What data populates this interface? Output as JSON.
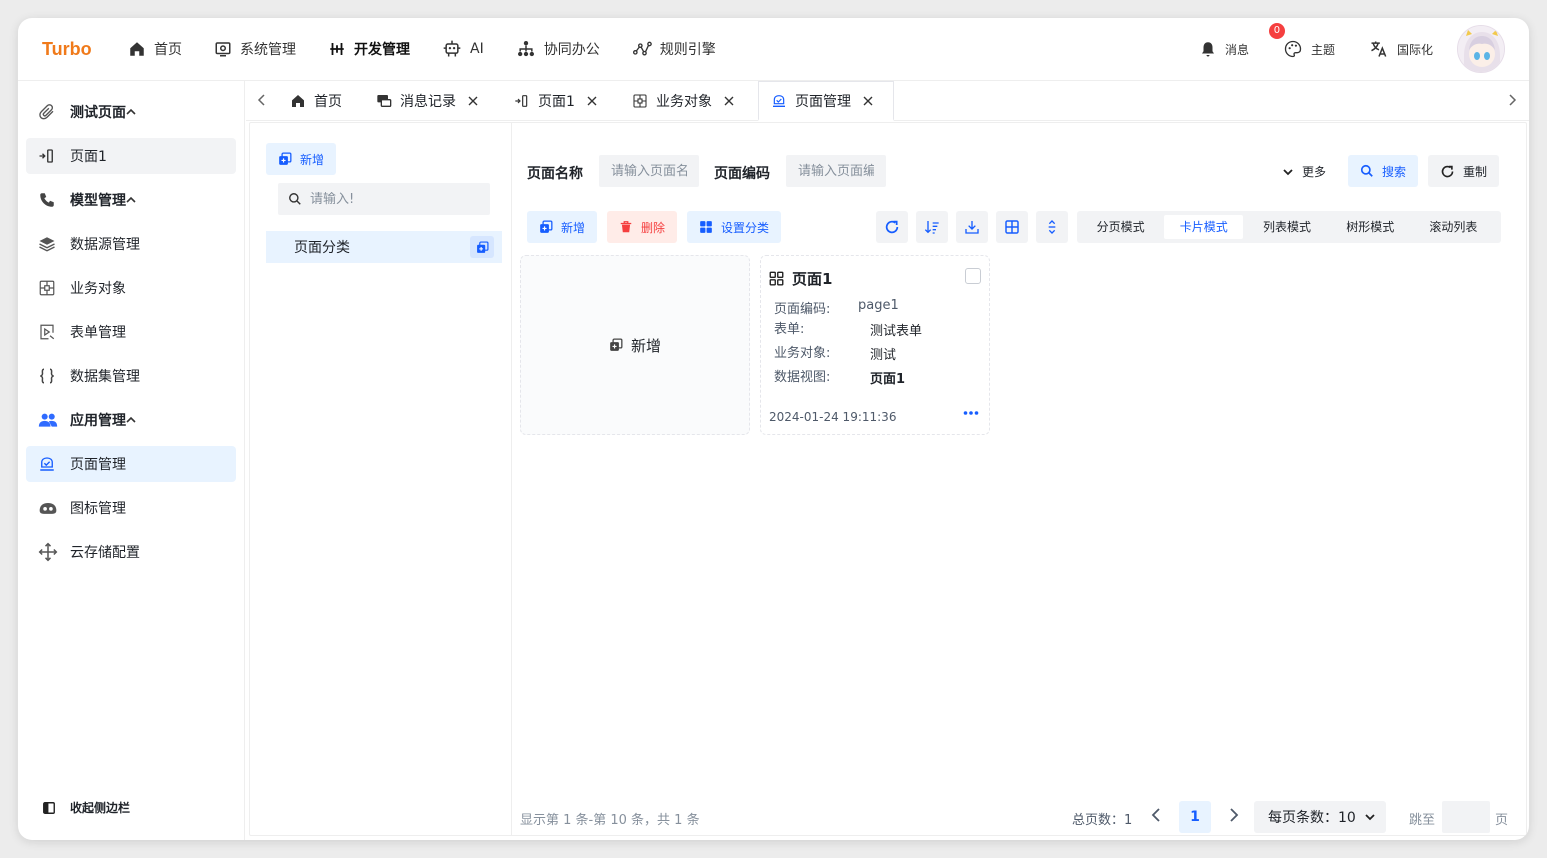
{
  "app": {
    "logo": "Turbo"
  },
  "topnav": [
    {
      "label": "首页",
      "icon": "home-icon"
    },
    {
      "label": "系统管理",
      "icon": "monitor-icon"
    },
    {
      "label": "开发管理",
      "icon": "dev-icon",
      "active": true
    },
    {
      "label": "AI",
      "icon": "robot-icon"
    },
    {
      "label": "协同办公",
      "icon": "org-icon"
    },
    {
      "label": "规则引擎",
      "icon": "rule-icon"
    }
  ],
  "topright": {
    "messages": {
      "label": "消息",
      "badge": "0"
    },
    "theme": {
      "label": "主题"
    },
    "i18n": {
      "label": "国际化"
    }
  },
  "sidebar": {
    "items": [
      {
        "label": "测试页面",
        "icon": "paperclip-icon",
        "type": "group"
      },
      {
        "label": "页面1",
        "icon": "page-icon",
        "type": "item"
      },
      {
        "label": "模型管理",
        "icon": "phone-icon",
        "type": "group"
      },
      {
        "label": "数据源管理",
        "icon": "layers-icon",
        "type": "item"
      },
      {
        "label": "业务对象",
        "icon": "object-icon",
        "type": "item"
      },
      {
        "label": "表单管理",
        "icon": "form-icon",
        "type": "item"
      },
      {
        "label": "数据集管理",
        "icon": "braces-icon",
        "type": "item"
      },
      {
        "label": "应用管理",
        "icon": "users-icon",
        "type": "group"
      },
      {
        "label": "页面管理",
        "icon": "page-manage-icon",
        "type": "item",
        "selected": true
      },
      {
        "label": "图标管理",
        "icon": "icon-manage-icon",
        "type": "item"
      },
      {
        "label": "云存储配置",
        "icon": "move-icon",
        "type": "item"
      }
    ],
    "collapse_label": "收起侧边栏"
  },
  "tabs": [
    {
      "label": "首页",
      "icon": "home-icon",
      "closable": false
    },
    {
      "label": "消息记录",
      "icon": "message-icon",
      "closable": true
    },
    {
      "label": "页面1",
      "icon": "page-icon",
      "closable": true
    },
    {
      "label": "业务对象",
      "icon": "object-icon",
      "closable": true
    },
    {
      "label": "页面管理",
      "icon": "page-manage-icon",
      "closable": true,
      "active": true
    }
  ],
  "tree": {
    "add_label": "新增",
    "search_placeholder": "请输入!",
    "node_label": "页面分类"
  },
  "filters": {
    "name_label": "页面名称",
    "name_placeholder": "请输入页面名称",
    "code_label": "页面编码",
    "code_placeholder": "请输入页面编码",
    "more_label": "更多",
    "search_label": "搜索",
    "reset_label": "重制"
  },
  "toolbar": {
    "add_label": "新增",
    "delete_label": "删除",
    "category_label": "设置分类",
    "modes": [
      "分页模式",
      "卡片模式",
      "列表模式",
      "树形模式",
      "滚动列表"
    ],
    "active_mode": "卡片模式"
  },
  "cards": {
    "new_label": "新增",
    "items": [
      {
        "title": "页面1",
        "fields": [
          {
            "key": "页面编码:",
            "value": "page1"
          },
          {
            "key": "表单:",
            "value": "测试表单"
          },
          {
            "key": "业务对象:",
            "value": "测试"
          },
          {
            "key": "数据视图:",
            "value": "页面1"
          }
        ],
        "time": "2024-01-24 19:11:36"
      }
    ]
  },
  "pager": {
    "info": "显示第 1 条-第 10 条，共 1 条",
    "total_pages": "总页数：1",
    "current": "1",
    "page_size": "每页条数：10",
    "jump_label": "跳至",
    "page_unit": "页"
  },
  "colors": {
    "accent": "#165dff",
    "logo": "#f07a1a",
    "danger": "#f53f3f"
  }
}
